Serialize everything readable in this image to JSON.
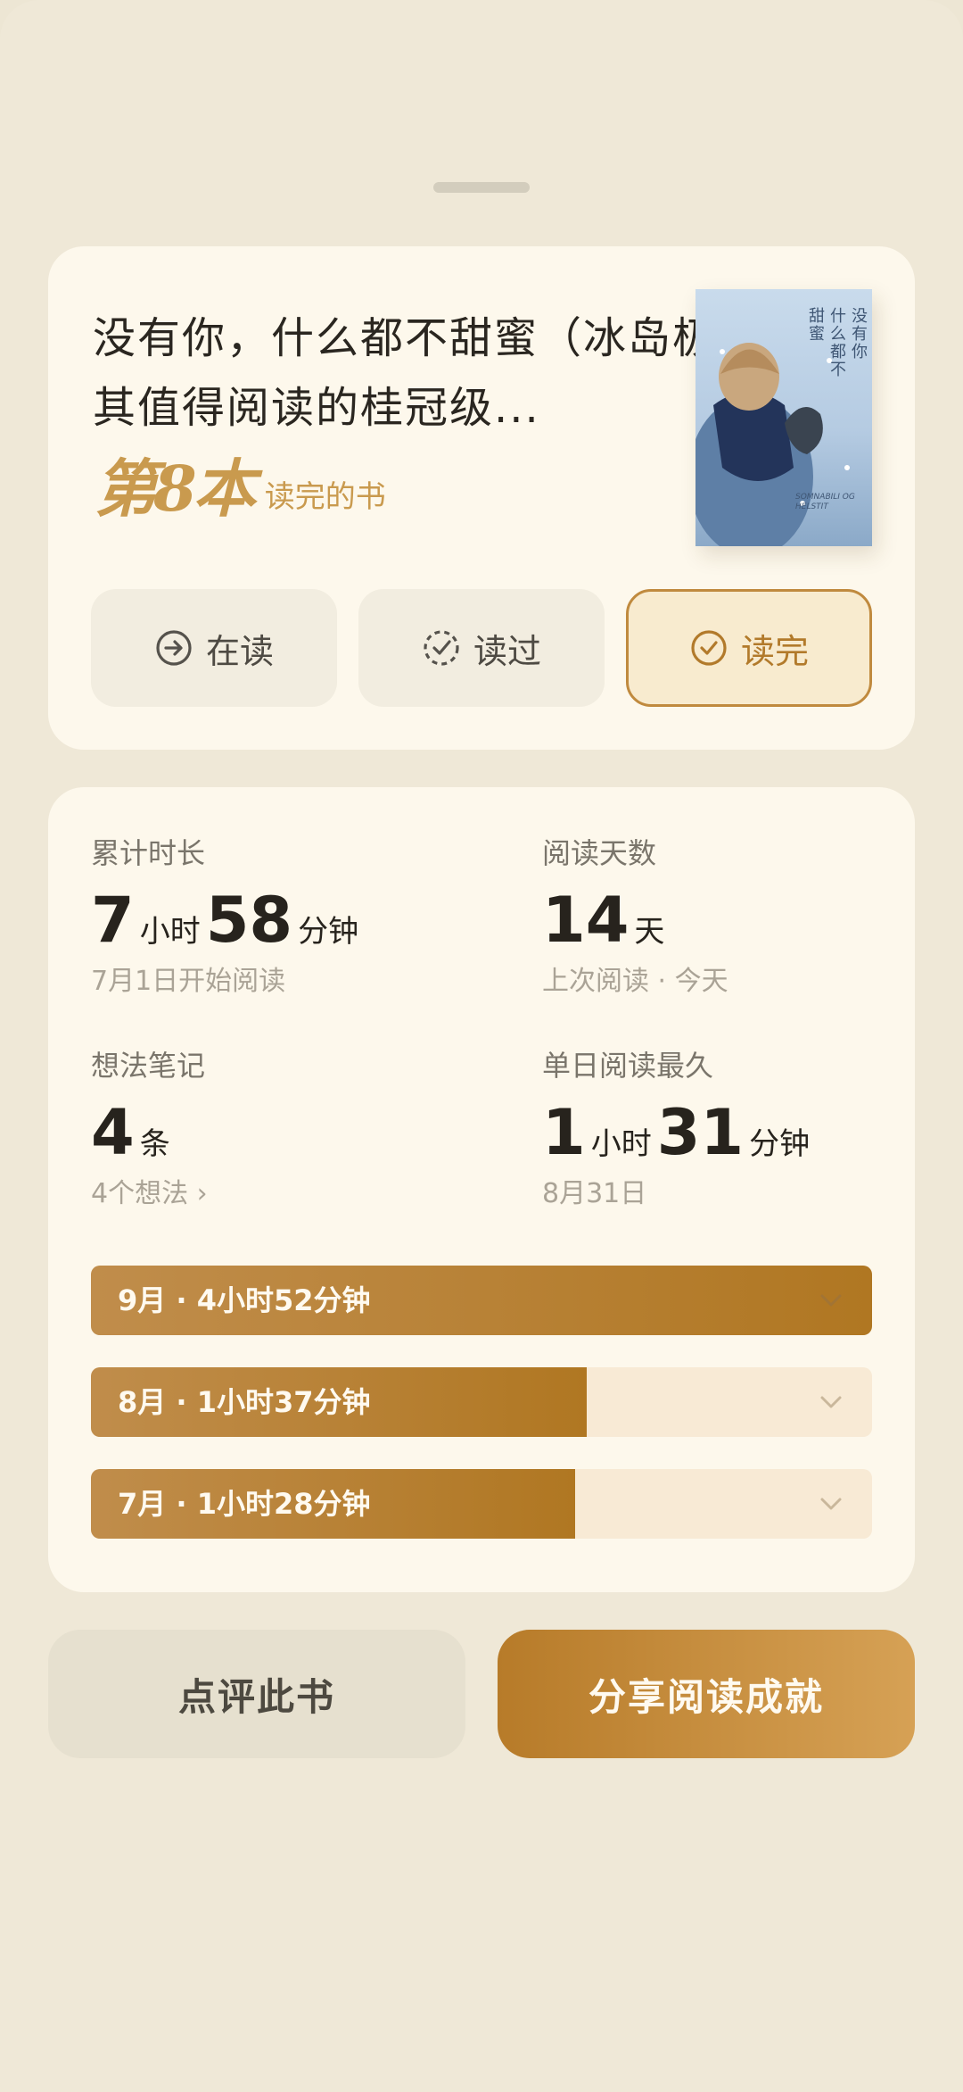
{
  "book": {
    "title": "没有你，什么都不甜蜜（冰岛极其值得阅读的桂冠级...",
    "rank_big": "第8本",
    "rank_label": "读完的书",
    "cover": {
      "title_vertical_1": "没有你",
      "title_vertical_2": "什么都不",
      "title_vertical_3": "甜蜜",
      "latin": "SOMNABILI OG HELSTIT"
    }
  },
  "status": {
    "options": [
      {
        "label": "在读",
        "icon": "arrow-right-circle-icon",
        "active": false
      },
      {
        "label": "读过",
        "icon": "dashed-check-circle-icon",
        "active": false
      },
      {
        "label": "读完",
        "icon": "check-circle-icon",
        "active": true
      }
    ]
  },
  "stats": {
    "total_time": {
      "label": "累计时长",
      "hours": "7",
      "hours_unit": "小时",
      "minutes": "58",
      "minutes_unit": "分钟",
      "sub": "7月1日开始阅读"
    },
    "days": {
      "label": "阅读天数",
      "value": "14",
      "unit": "天",
      "sub": "上次阅读 · 今天"
    },
    "notes": {
      "label": "想法笔记",
      "value": "4",
      "unit": "条",
      "sub": "4个想法 ›"
    },
    "longest_day": {
      "label": "单日阅读最久",
      "hours": "1",
      "hours_unit": "小时",
      "minutes": "31",
      "minutes_unit": "分钟",
      "sub": "8月31日"
    }
  },
  "months": [
    {
      "label": "9月 · 4小时52分钟",
      "fraction": 1.0
    },
    {
      "label": "8月 · 1小时37分钟",
      "fraction": 0.635
    },
    {
      "label": "7月 · 1小时28分钟",
      "fraction": 0.62
    }
  ],
  "actions": {
    "review": "点评此书",
    "share": "分享阅读成就"
  },
  "colors": {
    "accent": "#b77b29",
    "card_bg": "#fdf8ec",
    "page_bg": "#efe8d7"
  }
}
